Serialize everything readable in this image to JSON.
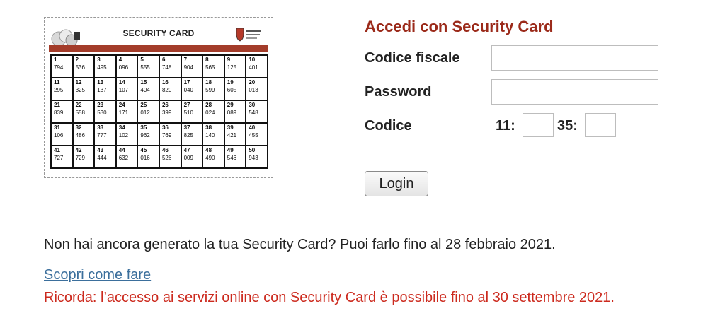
{
  "card": {
    "title": "SECURITY CARD",
    "rows": [
      [
        [
          "1",
          "794"
        ],
        [
          "2",
          "536"
        ],
        [
          "3",
          "495"
        ],
        [
          "4",
          "096"
        ],
        [
          "5",
          "555"
        ],
        [
          "6",
          "748"
        ],
        [
          "7",
          "904"
        ],
        [
          "8",
          "565"
        ],
        [
          "9",
          "125"
        ],
        [
          "10",
          "401"
        ]
      ],
      [
        [
          "11",
          "295"
        ],
        [
          "12",
          "325"
        ],
        [
          "13",
          "137"
        ],
        [
          "14",
          "107"
        ],
        [
          "15",
          "404"
        ],
        [
          "16",
          "820"
        ],
        [
          "17",
          "040"
        ],
        [
          "18",
          "599"
        ],
        [
          "19",
          "605"
        ],
        [
          "20",
          "013"
        ]
      ],
      [
        [
          "21",
          "839"
        ],
        [
          "22",
          "558"
        ],
        [
          "23",
          "530"
        ],
        [
          "24",
          "171"
        ],
        [
          "25",
          "012"
        ],
        [
          "26",
          "399"
        ],
        [
          "27",
          "510"
        ],
        [
          "28",
          "024"
        ],
        [
          "29",
          "089"
        ],
        [
          "30",
          "548"
        ]
      ],
      [
        [
          "31",
          "106"
        ],
        [
          "32",
          "486"
        ],
        [
          "33",
          "777"
        ],
        [
          "34",
          "102"
        ],
        [
          "35",
          "962"
        ],
        [
          "36",
          "769"
        ],
        [
          "37",
          "825"
        ],
        [
          "38",
          "140"
        ],
        [
          "39",
          "421"
        ],
        [
          "40",
          "455"
        ]
      ],
      [
        [
          "41",
          "727"
        ],
        [
          "42",
          "729"
        ],
        [
          "43",
          "444"
        ],
        [
          "44",
          "632"
        ],
        [
          "45",
          "016"
        ],
        [
          "46",
          "526"
        ],
        [
          "47",
          "009"
        ],
        [
          "48",
          "490"
        ],
        [
          "49",
          "546"
        ],
        [
          "50",
          "943"
        ]
      ]
    ],
    "accent_color": "#a33c2a"
  },
  "login": {
    "title": "Accedi con Security Card",
    "fiscal_code_label": "Codice fiscale",
    "fiscal_code_value": "",
    "password_label": "Password",
    "password_value": "",
    "code_label": "Codice",
    "position_1": "11:",
    "position_1_value": "",
    "position_2": "35:",
    "position_2_value": "",
    "button_label": "Login",
    "title_color": "#9b2a1a"
  },
  "notice": {
    "text": "Non hai ancora generato la tua Security Card? Puoi farlo fino al 28 febbraio 2021.",
    "link_label": "Scopri come fare",
    "reminder": "Ricorda: l’accesso ai servizi online con Security Card è possibile fino al 30 settembre 2021.",
    "reminder_color": "#cc2a1e",
    "link_color": "#3b6f9c"
  }
}
